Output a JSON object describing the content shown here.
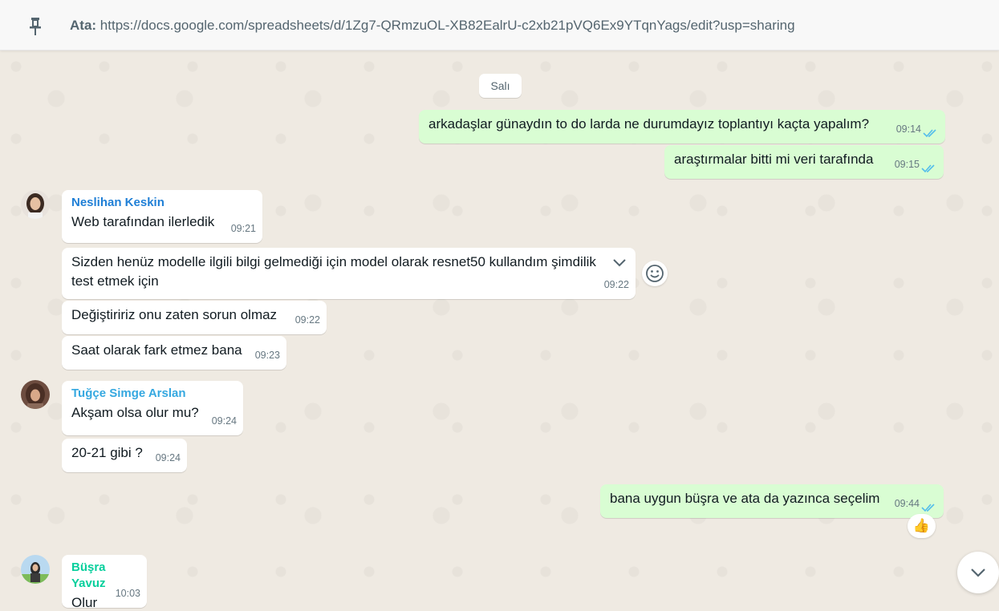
{
  "pinned": {
    "label": "Ata:",
    "text": "https://docs.google.com/spreadsheets/d/1Zg7-QRmzuOL-XB82EalrU-c2xb21pVQ6Ex9YTqnYags/edit?usp=sharing"
  },
  "date_chip": "Salı",
  "messages": [
    {
      "dir": "out",
      "text": "arkadaşlar günaydın to do larda ne durumdayız toplantıyı kaçta yapalım?",
      "time": "09:14"
    },
    {
      "dir": "out",
      "text": "araştırmalar bitti mi veri tarafında",
      "time": "09:15"
    },
    {
      "dir": "in",
      "sender": "Neslihan Keskin",
      "text": "Web tarafından ilerledik",
      "time": "09:21"
    },
    {
      "dir": "in",
      "text_line1": "Sizden henüz modelle ilgili bilgi gelmediği için  model olarak resnet50 kullandım şimdilik",
      "text_line2": "test etmek için",
      "time": "09:22"
    },
    {
      "dir": "in",
      "text": "Değiştiririz onu zaten sorun olmaz",
      "time": "09:22"
    },
    {
      "dir": "in",
      "text": "Saat olarak fark etmez bana",
      "time": "09:23"
    },
    {
      "dir": "in",
      "sender": "Tuğçe Simge Arslan",
      "text": "Akşam olsa olur mu?",
      "time": "09:24"
    },
    {
      "dir": "in",
      "text": "20-21 gibi ?",
      "time": "09:24"
    },
    {
      "dir": "out",
      "text": "bana uygun büşra ve ata da yazınca seçelim",
      "time": "09:44",
      "reaction": "👍"
    },
    {
      "dir": "in",
      "sender": "Büşra Yavuz",
      "text": "Olur",
      "time": "10:03"
    }
  ],
  "colors": {
    "bg": "#efeae2",
    "outgoing": "#d9fdd3",
    "incoming": "#ffffff",
    "sender_neslihan": "#1f7fd6",
    "sender_tugce": "#35a8e0",
    "sender_busra": "#06cf9c",
    "tick_blue": "#53bdeb"
  }
}
